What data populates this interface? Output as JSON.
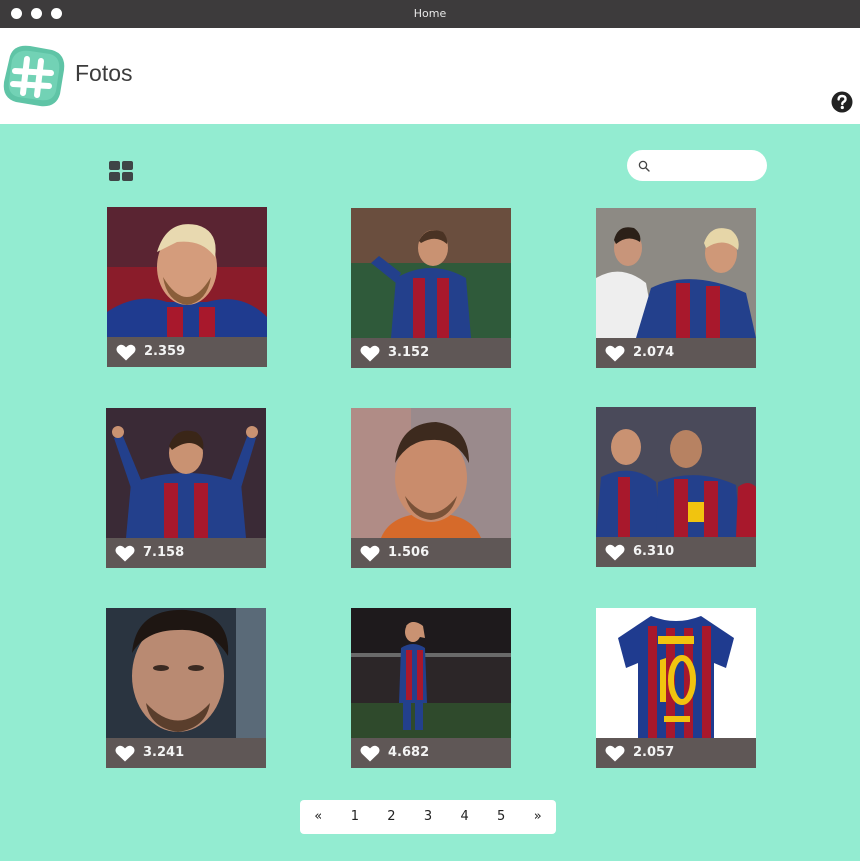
{
  "window": {
    "title": "Home"
  },
  "header": {
    "title": "Fotos"
  },
  "search": {
    "value": "",
    "placeholder": ""
  },
  "photos": [
    {
      "likes": "2.359",
      "alt": "Messi portrait"
    },
    {
      "likes": "3.152",
      "alt": "Messi running"
    },
    {
      "likes": "2.074",
      "alt": "Ronaldo and Messi"
    },
    {
      "likes": "7.158",
      "alt": "Messi celebrating"
    },
    {
      "likes": "1.506",
      "alt": "Messi close-up"
    },
    {
      "likes": "6.310",
      "alt": "Team hugging"
    },
    {
      "likes": "3.241",
      "alt": "Messi face"
    },
    {
      "likes": "4.682",
      "alt": "Messi on pitch"
    },
    {
      "likes": "2.057",
      "alt": "Barcelona jersey"
    }
  ],
  "pagination": {
    "prev": "«",
    "pages": [
      "1",
      "2",
      "3",
      "4",
      "5"
    ],
    "next": "»"
  },
  "colors": {
    "background": "#93ecd1",
    "titlebar": "#3d3b3c",
    "card": "#5f5756",
    "logo": "#5fc4a6"
  },
  "icons": {
    "logo": "hashtag-icon",
    "help": "question-circle-icon",
    "grid": "grid-view-icon",
    "search": "search-icon",
    "heart": "heart-icon"
  }
}
